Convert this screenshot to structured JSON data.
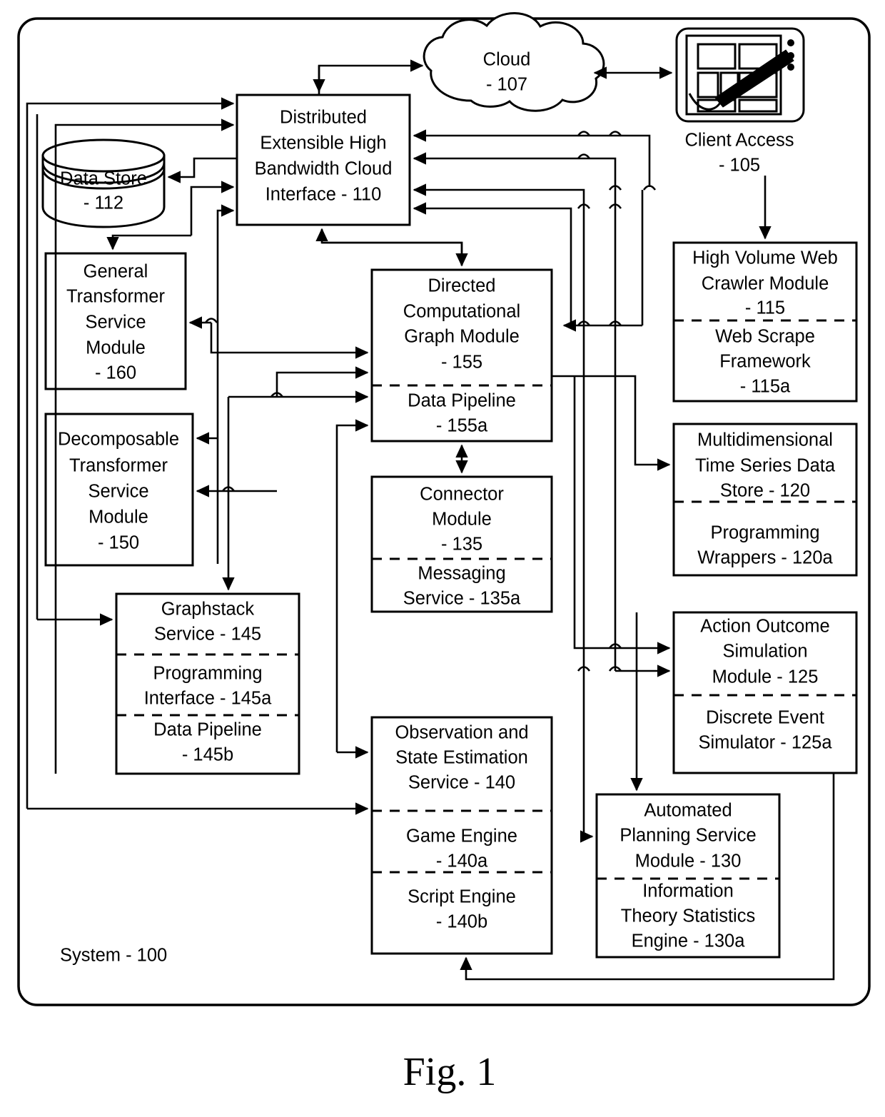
{
  "figure": {
    "caption": "Fig. 1",
    "system_label": "System - 100"
  },
  "nodes": {
    "cloud": {
      "line1": "Cloud",
      "line2": "- 107"
    },
    "client_access": {
      "line1": "Client Access",
      "line2": "- 105"
    },
    "cloud_interface": {
      "line1": "Distributed",
      "line2": "Extensible High",
      "line3": "Bandwidth Cloud",
      "line4": "Interface - 110"
    },
    "data_store": {
      "line1": "Data Store",
      "line2": "- 112"
    },
    "general_transformer": {
      "line1": "General",
      "line2": "Transformer",
      "line3": "Service",
      "line4": "Module",
      "line5": "- 160"
    },
    "decomposable_transformer": {
      "line1": "Decomposable",
      "line2": "Transformer",
      "line3": "Service",
      "line4": "Module",
      "line5": "- 150"
    },
    "graphstack": {
      "head_line1": "Graphstack",
      "head_line2": "Service - 145",
      "sub1_line1": "Programming",
      "sub1_line2": "Interface - 145a",
      "sub2_line1": "Data Pipeline",
      "sub2_line2": "- 145b"
    },
    "directed_graph": {
      "head_line1": "Directed",
      "head_line2": "Computational",
      "head_line3": "Graph Module",
      "head_line4": "- 155",
      "sub1_line1": "Data Pipeline",
      "sub1_line2": "- 155a"
    },
    "connector": {
      "head_line1": "Connector",
      "head_line2": "Module",
      "head_line3": "- 135",
      "sub1_line1": "Messaging",
      "sub1_line2": "Service - 135a"
    },
    "observation": {
      "head_line1": "Observation and",
      "head_line2": "State Estimation",
      "head_line3": "Service - 140",
      "sub1_line1": "Game Engine",
      "sub1_line2": "- 140a",
      "sub2_line1": "Script Engine",
      "sub2_line2": "- 140b"
    },
    "web_crawler": {
      "head_line1": "High Volume Web",
      "head_line2": "Crawler Module",
      "head_line3": "- 115",
      "sub1_line1": "Web Scrape",
      "sub1_line2": "Framework",
      "sub1_line3": "- 115a"
    },
    "time_series": {
      "head_line1": "Multidimensional",
      "head_line2": "Time Series Data",
      "head_line3": "Store - 120",
      "sub1_line1": "Programming",
      "sub1_line2": "Wrappers - 120a"
    },
    "action_outcome": {
      "head_line1": "Action Outcome",
      "head_line2": "Simulation",
      "head_line3": "Module - 125",
      "sub1_line1": "Discrete Event",
      "sub1_line2": "Simulator - 125a"
    },
    "automated_planning": {
      "head_line1": "Automated",
      "head_line2": "Planning Service",
      "head_line3": "Module - 130",
      "sub1_line1": "Information",
      "sub1_line2": "Theory Statistics",
      "sub1_line3": "Engine - 130a"
    }
  },
  "colors": {
    "stroke": "#000000",
    "fill": "#ffffff"
  }
}
